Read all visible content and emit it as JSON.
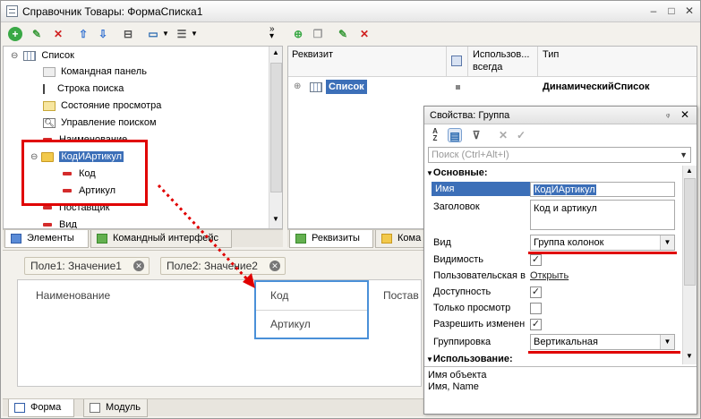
{
  "window": {
    "title": "Справочник Товары: ФормаСписка1"
  },
  "left_tree": {
    "items": [
      {
        "label": "Список"
      },
      {
        "label": "Командная панель"
      },
      {
        "label": "Строка поиска"
      },
      {
        "label": "Состояние просмотра"
      },
      {
        "label": "Управление поиском"
      },
      {
        "label": "Наименование"
      },
      {
        "label": "КодИАртикул"
      },
      {
        "label": "Код"
      },
      {
        "label": "Артикул"
      },
      {
        "label": "Поставщик"
      },
      {
        "label": "Вид"
      }
    ],
    "tabs": [
      "Элементы",
      "Командный интерфейс"
    ]
  },
  "right_panel": {
    "columns": [
      "Реквизит",
      "Использов... всегда",
      "Тип"
    ],
    "col2_line1": "Использов...",
    "col2_line2": "всегда",
    "row": {
      "name": "Список",
      "type": "ДинамическийСписок"
    },
    "tabs": [
      "Реквизиты",
      "Кома"
    ]
  },
  "preview": {
    "chips": [
      "Поле1: Значение1",
      "Поле2: Значение2"
    ],
    "header_name": "Наименование",
    "header_code": "Код",
    "header_article": "Артикул",
    "header_supplier": "Постав"
  },
  "bottom_tabs": [
    "Форма",
    "Модуль"
  ],
  "properties": {
    "title": "Свойства: Группа",
    "pin": "ᵩ",
    "search_placeholder": "Поиск (Ctrl+Alt+I)",
    "section_main": "Основные:",
    "section_usage": "Использование:",
    "name_label": "Имя",
    "name_value": "КодИАртикул",
    "caption_label": "Заголовок",
    "caption_value": "Код и артикул",
    "kind_label": "Вид",
    "kind_value": "Группа колонок",
    "visible_label": "Видимость",
    "user_visible_label": "Пользовательская в",
    "user_visible_link": "Открыть",
    "enabled_label": "Доступность",
    "readonly_label": "Только просмотр",
    "allow_change_label": "Разрешить изменен",
    "grouping_label": "Группировка",
    "grouping_value": "Вертикальная",
    "footer_line1": "Имя объекта",
    "footer_line2": "Имя, Name"
  }
}
